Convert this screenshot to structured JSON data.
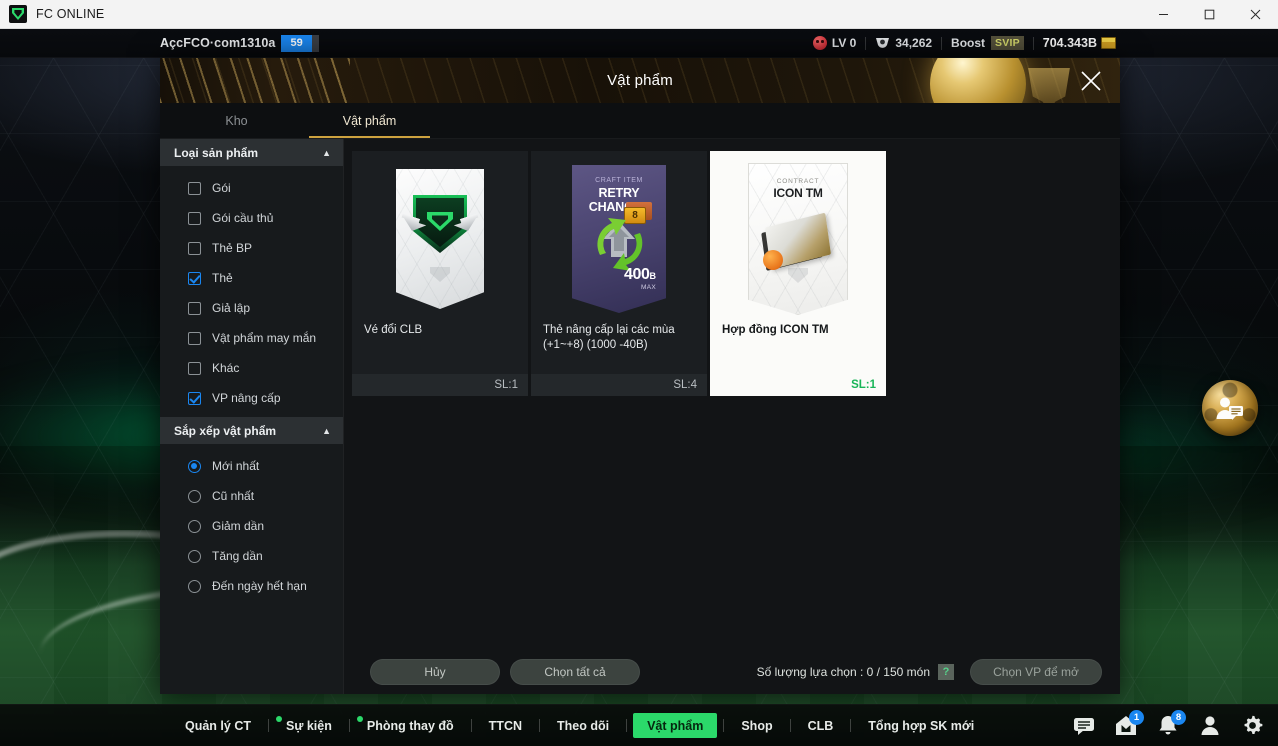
{
  "window": {
    "title": "FC ONLINE",
    "logo_icon": "fc-logo-icon",
    "minimize_icon": "minimize-icon",
    "maximize_icon": "maximize-icon",
    "close_icon": "close-icon"
  },
  "topbar": {
    "account_name": "AçcFCO·com1310a",
    "account_level": "59",
    "level_label": "LV 0",
    "level_icon": "sad-face-icon",
    "coin_icon": "coin-icon",
    "coins": "34,262",
    "boost_label": "Boost",
    "vip_badge": "SVIP",
    "bp_amount": "704.343B",
    "bp_icon": "bp-icon"
  },
  "modal": {
    "title": "Vật phẩm",
    "close_icon": "close-icon",
    "tabs": [
      {
        "label": "Kho",
        "active": false
      },
      {
        "label": "Vật phẩm",
        "active": true
      }
    ]
  },
  "sidebar": {
    "filter_section": {
      "title": "Loại sản phẩm",
      "collapse_icon": "chevron-up-icon",
      "options": [
        {
          "label": "Gói",
          "checked": false
        },
        {
          "label": "Gói cầu thủ",
          "checked": false
        },
        {
          "label": "Thẻ BP",
          "checked": false
        },
        {
          "label": "Thẻ",
          "checked": true
        },
        {
          "label": "Giả lập",
          "checked": false
        },
        {
          "label": "Vật phẩm may mắn",
          "checked": false
        },
        {
          "label": "Khác",
          "checked": false
        },
        {
          "label": "VP nâng cấp",
          "checked": true
        }
      ]
    },
    "sort_section": {
      "title": "Sắp xếp vật phẩm",
      "collapse_icon": "chevron-up-icon",
      "options": [
        {
          "label": "Mới nhất",
          "selected": true
        },
        {
          "label": "Cũ nhất",
          "selected": false
        },
        {
          "label": "Giảm dần",
          "selected": false
        },
        {
          "label": "Tăng dần",
          "selected": false
        },
        {
          "label": "Đến ngày hết hạn",
          "selected": false
        }
      ]
    }
  },
  "items": [
    {
      "name": "Vé đổi CLB",
      "quantity_label": "SL:1",
      "selected": false,
      "art": {
        "type": "pack",
        "watermark": "fc-logo-icon"
      }
    },
    {
      "name": "Thẻ nâng cấp lại các mùa (+1~+8) (1000 -40B)",
      "quantity_label": "SL:4",
      "selected": false,
      "art": {
        "type": "retry",
        "craft_label": "CRAFT ITEM",
        "title": "RETRY CHANCES",
        "box_count": "8",
        "price_value": "400",
        "price_unit": "B",
        "price_note": "MAX"
      }
    },
    {
      "name": "Hợp đồng ICON TM",
      "quantity_label": "SL:1",
      "selected": true,
      "art": {
        "type": "contract",
        "kicker": "CONTRACT",
        "title": "ICON TM",
        "watermark": "fc-logo-icon"
      }
    }
  ],
  "footer": {
    "cancel_label": "Hủy",
    "select_all_label": "Chọn tất cả",
    "count_text": "Số lượng lựa chọn : 0 / 150 món",
    "help_label": "?",
    "open_label": "Chọn VP để mở"
  },
  "chat_ball": {
    "icon": "person-chat-icon"
  },
  "bottomnav": {
    "items": [
      {
        "label": "Quản lý CT",
        "active": false,
        "dot": false
      },
      {
        "label": "Sự kiện",
        "active": false,
        "dot": true
      },
      {
        "label": "Phòng thay đồ",
        "active": false,
        "dot": true
      },
      {
        "label": "TTCN",
        "active": false,
        "dot": false
      },
      {
        "label": "Theo dõi",
        "active": false,
        "dot": false
      },
      {
        "label": "Vật phẩm",
        "active": true,
        "dot": false
      },
      {
        "label": "Shop",
        "active": false,
        "dot": false
      },
      {
        "label": "CLB",
        "active": false,
        "dot": false
      },
      {
        "label": "Tổng hợp SK mới",
        "active": false,
        "dot": false
      }
    ],
    "icons": [
      {
        "name": "chat-icon",
        "badge": ""
      },
      {
        "name": "home-mail-icon",
        "badge": "1"
      },
      {
        "name": "bell-icon",
        "badge": "8"
      },
      {
        "name": "profile-icon",
        "badge": ""
      },
      {
        "name": "gear-icon",
        "badge": ""
      }
    ]
  },
  "colors": {
    "accent_green": "#2bd96a",
    "accent_blue": "#1a86f0",
    "gold": "#cda23f"
  }
}
